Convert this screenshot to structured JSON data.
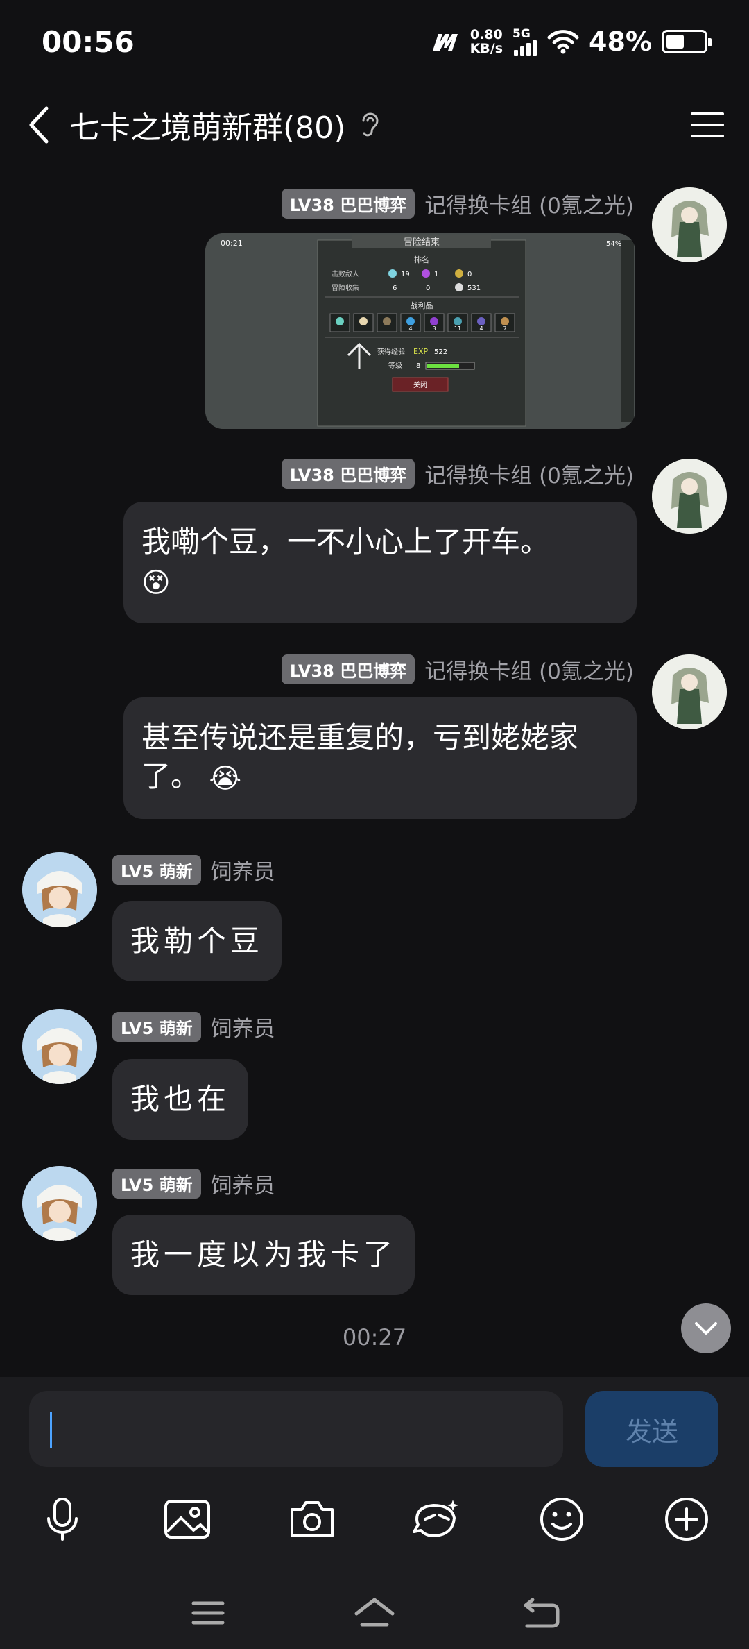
{
  "status": {
    "time": "00:56",
    "speed_value": "0.80",
    "speed_unit": "KB/s",
    "network": "5G",
    "battery_pct": "48%",
    "battery_level": 0.48
  },
  "header": {
    "title": "七卡之境萌新群(80)"
  },
  "messages": [
    {
      "side": "right",
      "level": "LV38 巴巴博弈",
      "sender": "记得换卡组 (0氪之光)",
      "type": "image",
      "image": {
        "time": "00:21",
        "battery": "54%",
        "title": "冒险结束",
        "rank_label": "排名",
        "kill_label": "击败敌人",
        "collect_label": "冒险收集",
        "kills": [
          "19",
          "1",
          "0"
        ],
        "collects": [
          "6",
          "0",
          "531"
        ],
        "loot_label": "战利品",
        "loot_counts": [
          "",
          "",
          "",
          "4",
          "3",
          "11",
          "4",
          "7"
        ],
        "exp_label": "获得经验",
        "exp_value": "522",
        "level_label": "等级",
        "level_value": "8",
        "close_label": "关闭"
      }
    },
    {
      "side": "right",
      "level": "LV38 巴巴博弈",
      "sender": "记得换卡组 (0氪之光)",
      "text": "我嘞个豆，一不小心上了开车。",
      "emoji": "😵"
    },
    {
      "side": "right",
      "level": "LV38 巴巴博弈",
      "sender": "记得换卡组 (0氪之光)",
      "text": "甚至传说还是重复的，亏到姥姥家了。",
      "emoji": "😭"
    },
    {
      "side": "left",
      "level": "LV5 萌新",
      "sender": "饲养员",
      "text": "我勒个豆"
    },
    {
      "side": "left",
      "level": "LV5 萌新",
      "sender": "饲养员",
      "text": "我也在"
    },
    {
      "side": "left",
      "level": "LV5 萌新",
      "sender": "饲养员",
      "text": "我一度以为我卡了"
    }
  ],
  "timestamp": "00:27",
  "composer": {
    "send_label": "发送"
  },
  "toolbar": [
    "microphone-icon",
    "image-icon",
    "camera-icon",
    "sticker-icon",
    "emoji-icon",
    "plus-icon"
  ],
  "navbar": [
    "menu-icon",
    "home-icon",
    "back-icon"
  ]
}
